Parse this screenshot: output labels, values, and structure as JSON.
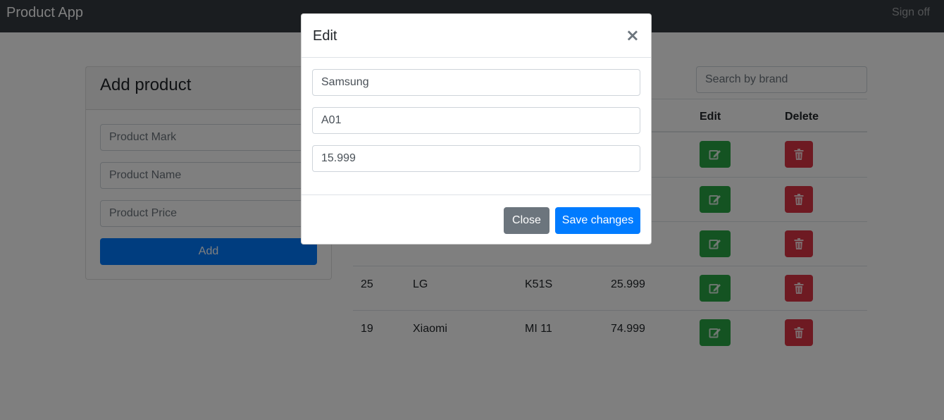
{
  "navbar": {
    "brand": "Product App",
    "signoff": "Sign off"
  },
  "add_card": {
    "title": "Add product",
    "mark_placeholder": "Product Mark",
    "name_placeholder": "Product Name",
    "price_placeholder": "Product Price",
    "add_label": "Add"
  },
  "search": {
    "placeholder": "Search by brand"
  },
  "table": {
    "headers": {
      "edit": "Edit",
      "delete": "Delete"
    },
    "rows": [
      {
        "id": "",
        "mark": "",
        "name": "",
        "price": ""
      },
      {
        "id": "",
        "mark": "",
        "name": "",
        "price": ""
      },
      {
        "id": "",
        "mark": "",
        "name": "",
        "price": ""
      },
      {
        "id": "25",
        "mark": "LG",
        "name": "K51S",
        "price": "25.999"
      },
      {
        "id": "19",
        "mark": "Xiaomi",
        "name": "MI 11",
        "price": "74.999"
      }
    ]
  },
  "modal": {
    "title": "Edit",
    "close_icon": "×",
    "mark_value": "Samsung",
    "name_value": "A01",
    "price_value": "15.999",
    "close_label": "Close",
    "save_label": "Save changes"
  },
  "icons": {
    "edit": "edit-icon",
    "delete": "trash-icon"
  },
  "colors": {
    "primary": "#007bff",
    "success": "#28a745",
    "danger": "#dc3545",
    "secondary": "#6c757d",
    "navbar": "#343a40"
  }
}
